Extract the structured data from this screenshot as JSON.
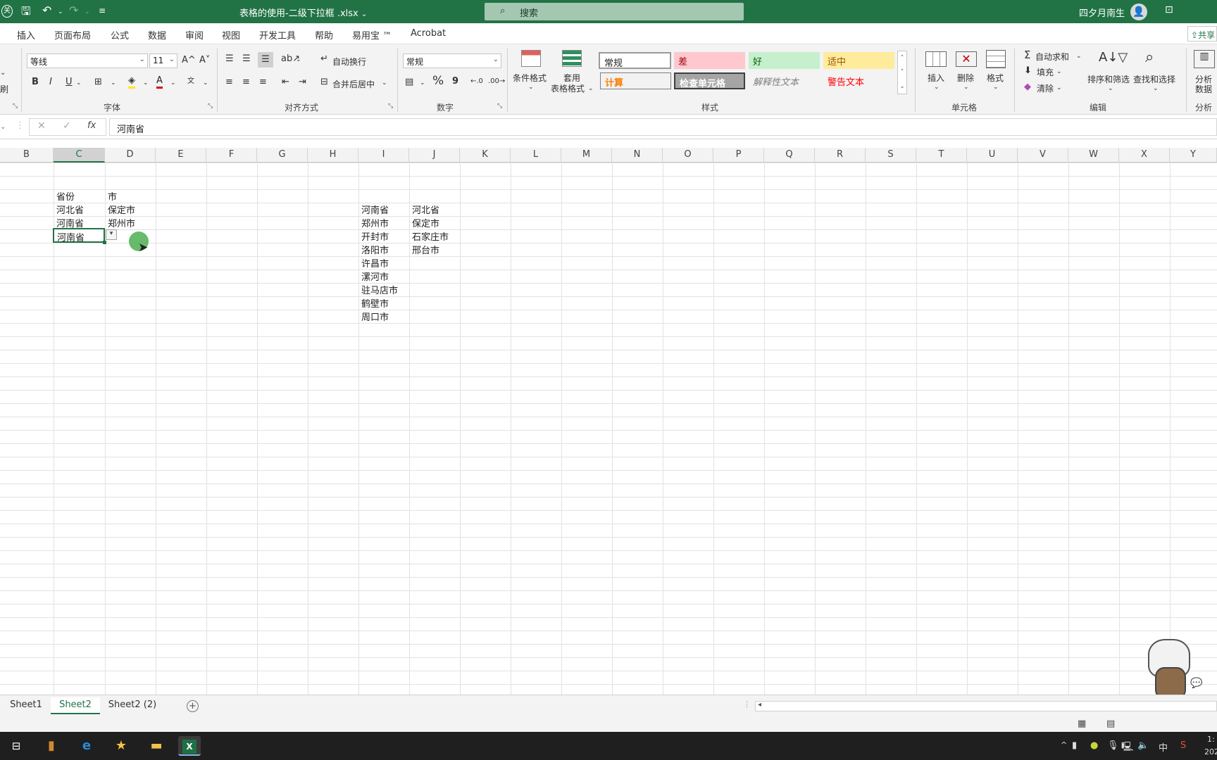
{
  "titlebar": {
    "file_title": "表格的使用-二级下拉框 .xlsx",
    "title_arrow": "⌄",
    "search_label": "搜索",
    "user_name": "四夕月南生",
    "left_chip": "关"
  },
  "menu": [
    "插入",
    "页面布局",
    "公式",
    "数据",
    "审阅",
    "视图",
    "开发工具",
    "帮助",
    "易用宝 ™",
    "Acrobat"
  ],
  "share_label": "共享",
  "ribbon": {
    "font_name": "等线",
    "font_size": "11",
    "grow_font": "A^",
    "shrink_font": "A˅",
    "bold": "B",
    "italic": "I",
    "underline": "U",
    "wrap_text": "自动换行",
    "merge_center": "合并后居中",
    "number_format": "常规",
    "percent": "%",
    "comma": "9",
    "group_font": "字体",
    "group_align": "对齐方式",
    "group_number": "数字",
    "group_styles": "样式",
    "group_cells": "单元格",
    "group_edit": "编辑",
    "group_analysis": "分析",
    "paste_tail": "刷",
    "cond_format": "条件格式",
    "table_format_1": "套用",
    "table_format_2": "表格格式",
    "styles": {
      "normal": "常规",
      "bad": "差",
      "good": "好",
      "neutral": "适中",
      "calc": "计算",
      "check": "检查单元格",
      "explain": "解释性文本",
      "warn": "警告文本"
    },
    "insert": "插入",
    "delete": "删除",
    "format": "格式",
    "autosum": "自动求和",
    "fill": "填充",
    "clear": "清除",
    "sort_filter": "排序和筛选",
    "find_select": "查找和选择",
    "analyze_1": "分析",
    "analyze_2": "数据"
  },
  "formula_bar": {
    "cancel": "✕",
    "confirm": "✓",
    "fx": "fx",
    "value": "河南省"
  },
  "columns": [
    "B",
    "C",
    "D",
    "E",
    "F",
    "G",
    "H",
    "I",
    "J",
    "K",
    "L",
    "M",
    "N",
    "O",
    "P",
    "Q",
    "R",
    "S",
    "T",
    "U",
    "V",
    "W",
    "X",
    "Y"
  ],
  "cells": {
    "C_header": "省份",
    "D_header": "市",
    "C1": "河北省",
    "D1": "保定市",
    "C2": "河南省",
    "D2": "郑州市",
    "C3": "河南省",
    "I_list": [
      "河南省",
      "郑州市",
      "开封市",
      "洛阳市",
      "许昌市",
      "漯河市",
      "驻马店市",
      "鹤壁市",
      "周口市"
    ],
    "J_list": [
      "河北省",
      "保定市",
      "石家庄市",
      "邢台市"
    ]
  },
  "sheets": [
    "Sheet1",
    "Sheet2",
    "Sheet2 (2)"
  ],
  "active_sheet": "Sheet2",
  "taskbar": {
    "ime": "中",
    "time_partial": "1:",
    "date_partial": "202"
  }
}
